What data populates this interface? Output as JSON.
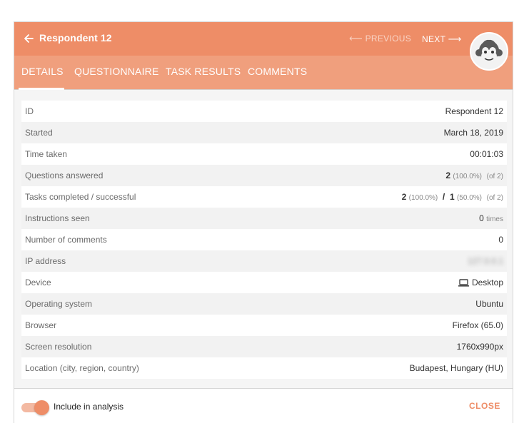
{
  "header": {
    "title": "Respondent 12",
    "prev_arrow": "⟵",
    "prev_label": "PREVIOUS",
    "next_label": "NEXT",
    "next_arrow": "⟶",
    "back_icon": "arrow-left-icon",
    "avatar_icon": "monkey-face-icon",
    "bg_color": "#ee8d67"
  },
  "tabs": [
    {
      "label": "DETAILS",
      "active": true
    },
    {
      "label": "QUESTIONNAIRE"
    },
    {
      "label": "TASK RESULTS"
    },
    {
      "label": "COMMENTS"
    }
  ],
  "details": {
    "id": {
      "label": "ID",
      "value": "Respondent 12"
    },
    "started": {
      "label": "Started",
      "value": "March 18, 2019"
    },
    "time_taken": {
      "label": "Time taken",
      "value": "00:01:03"
    },
    "questions": {
      "label": "Questions answered",
      "count": "2",
      "pct": "(100.0%)",
      "of": "(of 2)"
    },
    "tasks": {
      "label": "Tasks completed / successful",
      "completed": "2",
      "completed_pct": "(100.0%)",
      "sep": "/",
      "successful": "1",
      "successful_pct": "(50.0%)",
      "of": "(of 2)"
    },
    "instructions": {
      "label": "Instructions seen",
      "count": "0",
      "unit": "times"
    },
    "comments": {
      "label": "Number of comments",
      "value": "0"
    },
    "ip": {
      "label": "IP address",
      "value": "127.0.0.1"
    },
    "device": {
      "label": "Device",
      "icon": "laptop-icon",
      "value": "Desktop"
    },
    "os": {
      "label": "Operating system",
      "value": "Ubuntu"
    },
    "browser": {
      "label": "Browser",
      "value": "Firefox (65.0)"
    },
    "resolution": {
      "label": "Screen resolution",
      "value": "1760x990px"
    },
    "location": {
      "label": "Location (city, region, country)",
      "value": "Budapest, Hungary (HU)"
    }
  },
  "footer": {
    "toggle_label": "Include in analysis",
    "toggle_on": true,
    "close_label": "CLOSE"
  }
}
